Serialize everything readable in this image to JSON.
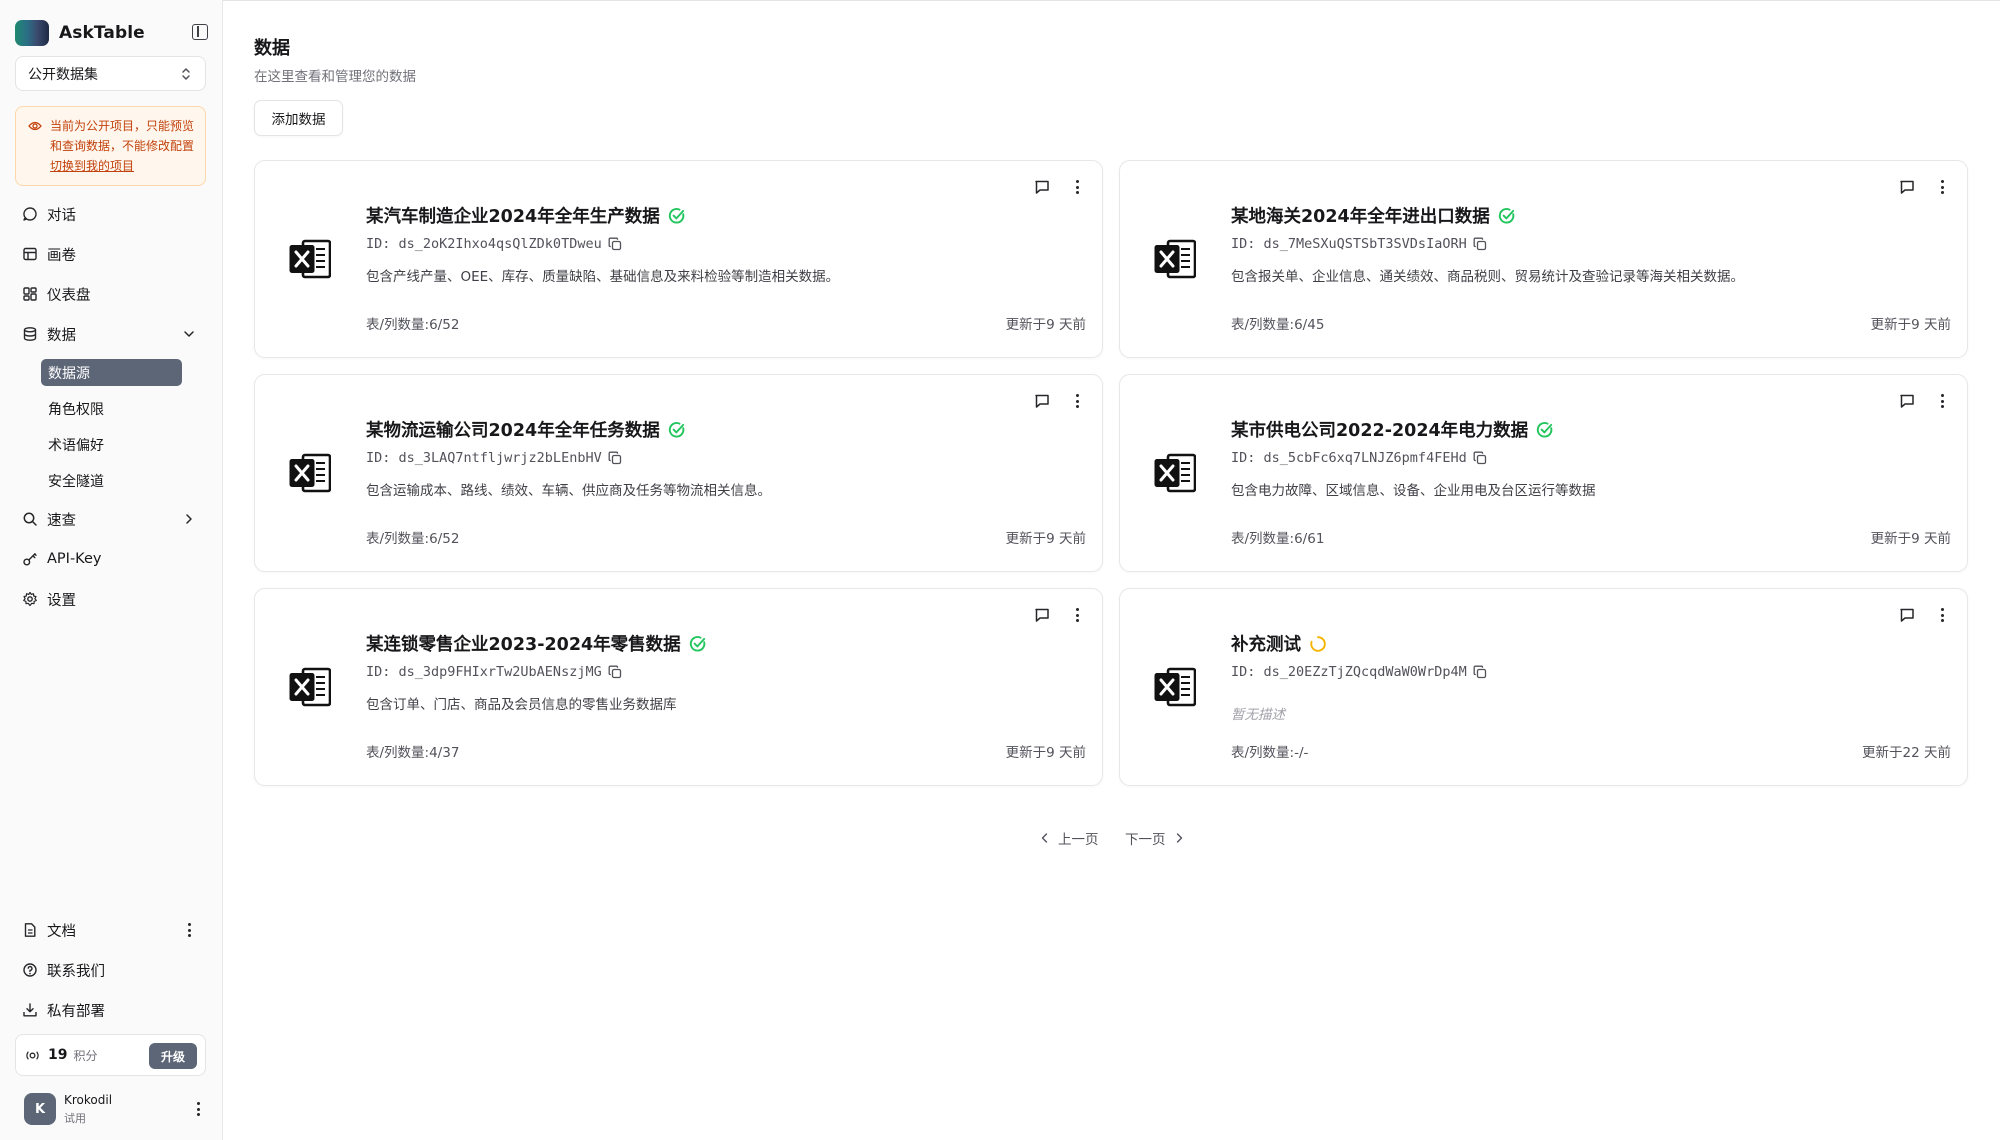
{
  "app": {
    "name": "AskTable"
  },
  "sidebar": {
    "project_select": "公开数据集",
    "notice": {
      "text": "当前为公开项目，只能预览和查询数据，不能修改配置",
      "link": "切换到我的项目"
    },
    "nav": {
      "chat": "对话",
      "canvas": "画卷",
      "dashboard": "仪表盘",
      "data": "数据",
      "quick": "速查",
      "api_key": "API-Key",
      "settings": "设置"
    },
    "subnav": [
      "数据源",
      "角色权限",
      "术语偏好",
      "安全隧道"
    ],
    "bottom": {
      "docs": "文档",
      "contact": "联系我们",
      "private": "私有部署"
    },
    "points": {
      "value": "19",
      "unit": "积分",
      "upgrade": "升级"
    },
    "user": {
      "initial": "K",
      "name": "Krokodil",
      "plan": "试用"
    }
  },
  "main": {
    "title": "数据",
    "subtitle": "在这里查看和管理您的数据",
    "add_button": "添加数据",
    "cards": [
      {
        "title": "某汽车制造企业2024年全年生产数据",
        "status": "done",
        "id": "ID: ds_2oK2Ihxo4qsQlZDk0TDweu",
        "desc": "包含产线产量、OEE、库存、质量缺陷、基础信息及来料检验等制造相关数据。",
        "count": "表/列数量:6/52",
        "updated": "更新于9 天前"
      },
      {
        "title": "某地海关2024年全年进出口数据",
        "status": "done",
        "id": "ID: ds_7MeSXuQSTSbT3SVDsIaORH",
        "desc": "包含报关单、企业信息、通关绩效、商品税则、贸易统计及查验记录等海关相关数据。",
        "count": "表/列数量:6/45",
        "updated": "更新于9 天前"
      },
      {
        "title": "某物流运输公司2024年全年任务数据",
        "status": "done",
        "id": "ID: ds_3LAQ7ntfljwrjz2bLEnbHV",
        "desc": "包含运输成本、路线、绩效、车辆、供应商及任务等物流相关信息。",
        "count": "表/列数量:6/52",
        "updated": "更新于9 天前"
      },
      {
        "title": "某市供电公司2022-2024年电力数据",
        "status": "done",
        "id": "ID: ds_5cbFc6xq7LNJZ6pmf4FEHd",
        "desc": "包含电力故障、区域信息、设备、企业用电及台区运行等数据",
        "count": "表/列数量:6/61",
        "updated": "更新于9 天前"
      },
      {
        "title": "某连锁零售企业2023-2024年零售数据",
        "status": "done",
        "id": "ID: ds_3dp9FHIxrTw2UbAENszjMG",
        "desc": "包含订单、门店、商品及会员信息的零售业务数据库",
        "count": "表/列数量:4/37",
        "updated": "更新于9 天前"
      },
      {
        "title": "补充测试",
        "status": "loading",
        "id": "ID: ds_20EZzTjZQcqdWaW0WrDp4M",
        "desc": "暂无描述",
        "count": "表/列数量:-/-",
        "updated": "更新于22 天前"
      }
    ],
    "pagination": {
      "prev": "上一页",
      "next": "下一页"
    }
  },
  "colors": {
    "success": "#22c55e",
    "loading": "#f5b400",
    "primary": "#5d6677",
    "warning": "#c2410c"
  }
}
